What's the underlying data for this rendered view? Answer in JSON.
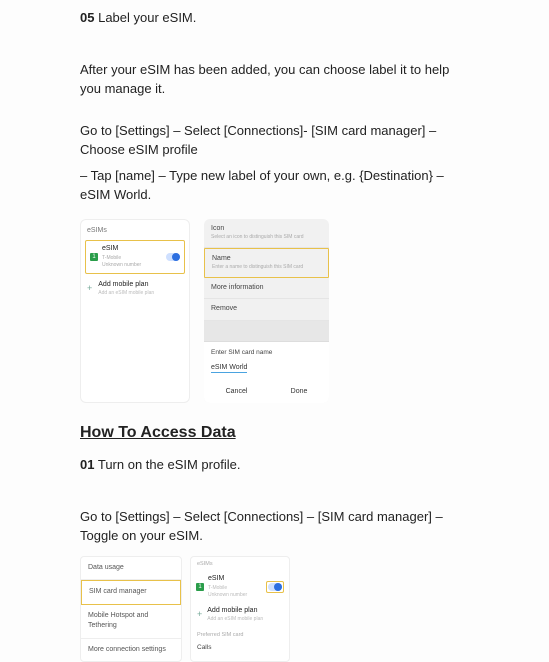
{
  "step05": {
    "num": "05",
    "title": "Label your eSIM."
  },
  "p1": "After your eSIM has been added, you can choose label it to help you manage it.",
  "p2": "Go to [Settings] – Select [Connections]- [SIM card manager] – Choose eSIM profile",
  "p3": "– Tap [name] – Type new label of your own, e.g. {Destination} – eSIM World.",
  "fig1": {
    "left": {
      "header": "eSIMs",
      "esim": {
        "title": "eSIM",
        "sub1": "T-Mobile",
        "sub2": "Unknown number"
      },
      "add": {
        "title": "Add mobile plan",
        "sub": "Add an eSIM mobile plan"
      }
    },
    "right": {
      "icon": {
        "label": "Icon",
        "sub": "Select an icon to distinguish this SIM card"
      },
      "name": {
        "label": "Name",
        "sub": "Enter a name to distinguish this SIM card"
      },
      "more": "More information",
      "remove": "Remove",
      "entername": "Enter SIM card name",
      "value": "eSIM World",
      "cancel": "Cancel",
      "done": "Done"
    }
  },
  "section2": "How To Access Data",
  "step01": {
    "num": "01",
    "title": "Turn on the eSIM profile."
  },
  "p4": "Go to [Settings] – Select [Connections] – [SIM card manager] – Toggle on your eSIM.",
  "fig2": {
    "list": {
      "r1": "Data usage",
      "r2": "SIM card manager",
      "r3": "Mobile Hotspot and Tethering",
      "r4": "More connection settings"
    },
    "card": {
      "hdr": "eSIMs",
      "esim": {
        "title": "eSIM",
        "sub1": "T-Mobile",
        "sub2": "Unknown number"
      },
      "add": {
        "title": "Add mobile plan",
        "sub": "Add an eSIM mobile plan"
      },
      "pref": "Preferred SIM card",
      "calls": "Calls"
    }
  }
}
